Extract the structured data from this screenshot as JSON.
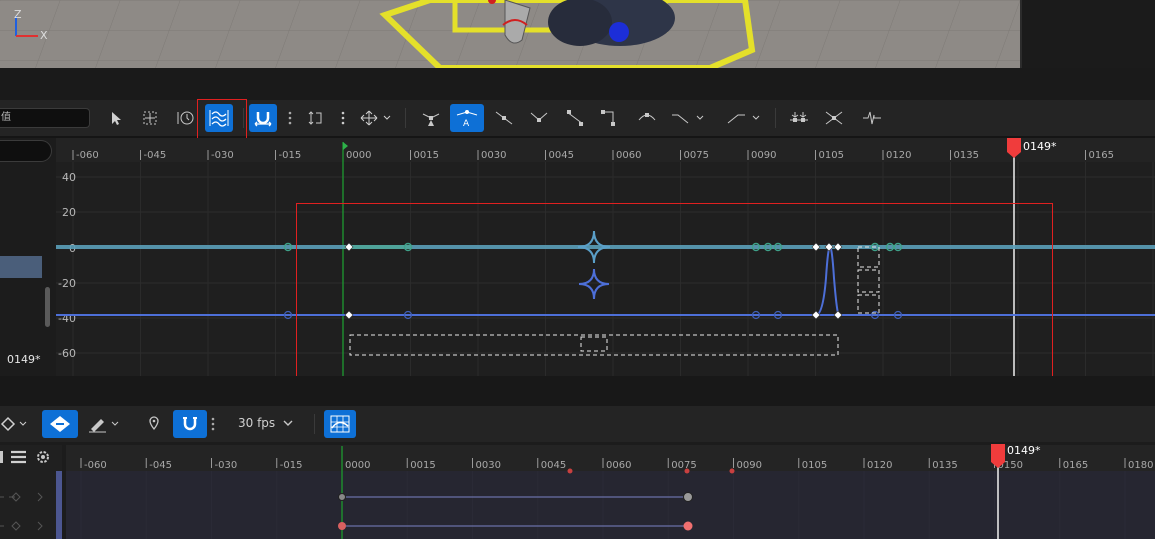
{
  "viewport": {
    "axis_z": "Z",
    "axis_x": "X"
  },
  "curve_toolbar": {
    "search_text": "值",
    "tools": [
      {
        "name": "select-tool",
        "icon": "cursor-arrow-icon"
      },
      {
        "name": "transform-tool",
        "icon": "transform-icon"
      },
      {
        "name": "retime-tool",
        "icon": "retime-icon"
      },
      {
        "name": "normalize-view",
        "icon": "wave-curves-icon",
        "active": true
      },
      {
        "name": "snap-toggle",
        "icon": "magnet-icon",
        "active": true
      },
      {
        "name": "flatten-tool",
        "icon": "flatten-icon"
      },
      {
        "name": "move-tool",
        "icon": "move-arrows-icon"
      },
      {
        "name": "tangent-auto",
        "icon": "tangent-auto-icon"
      },
      {
        "name": "tangent-auto-clamped",
        "icon": "tangent-auto-clamped-icon",
        "active": true
      },
      {
        "name": "tangent-user",
        "icon": "tangent-user-icon"
      },
      {
        "name": "tangent-break",
        "icon": "tangent-break-icon"
      },
      {
        "name": "tangent-linear",
        "icon": "tangent-linear-icon"
      },
      {
        "name": "tangent-constant",
        "icon": "tangent-constant-icon"
      },
      {
        "name": "tangent-weighted",
        "icon": "tangent-weighted-icon"
      },
      {
        "name": "pre-infinity",
        "icon": "pre-infinity-icon"
      },
      {
        "name": "post-infinity",
        "icon": "post-infinity-icon"
      },
      {
        "name": "key-reduce",
        "icon": "key-reduce-icon"
      },
      {
        "name": "key-flatten",
        "icon": "key-flatten-icon"
      },
      {
        "name": "filter-curves",
        "icon": "filter-icon"
      }
    ]
  },
  "left_panel": {
    "current_time": "0149*"
  },
  "curve_ruler": {
    "ticks": [
      "-060",
      "-045",
      "-030",
      "-015",
      "0000",
      "0015",
      "0030",
      "0045",
      "0060",
      "0075",
      "0090",
      "0105",
      "0120",
      "0135",
      "0165"
    ],
    "playhead_label": "0149*"
  },
  "curve_y_axis": {
    "labels": [
      "40",
      "20",
      "0",
      "-20",
      "-40",
      "-60"
    ]
  },
  "seq_toolbar": {
    "fps": "30 fps"
  },
  "seq_ruler": {
    "ticks": [
      "-060",
      "-045",
      "-030",
      "-015",
      "0000",
      "0015",
      "0030",
      "0045",
      "0060",
      "0075",
      "0090",
      "0105",
      "0120",
      "0135",
      "0150",
      "0165",
      "0180"
    ],
    "playhead_label": "0149*"
  },
  "colors": {
    "accent": "#0e70d6",
    "curve_teal": "#5a9fb8",
    "curve_blue": "#4d6fd8",
    "playhead": "#f03c3c",
    "highlight": "#e02020"
  }
}
